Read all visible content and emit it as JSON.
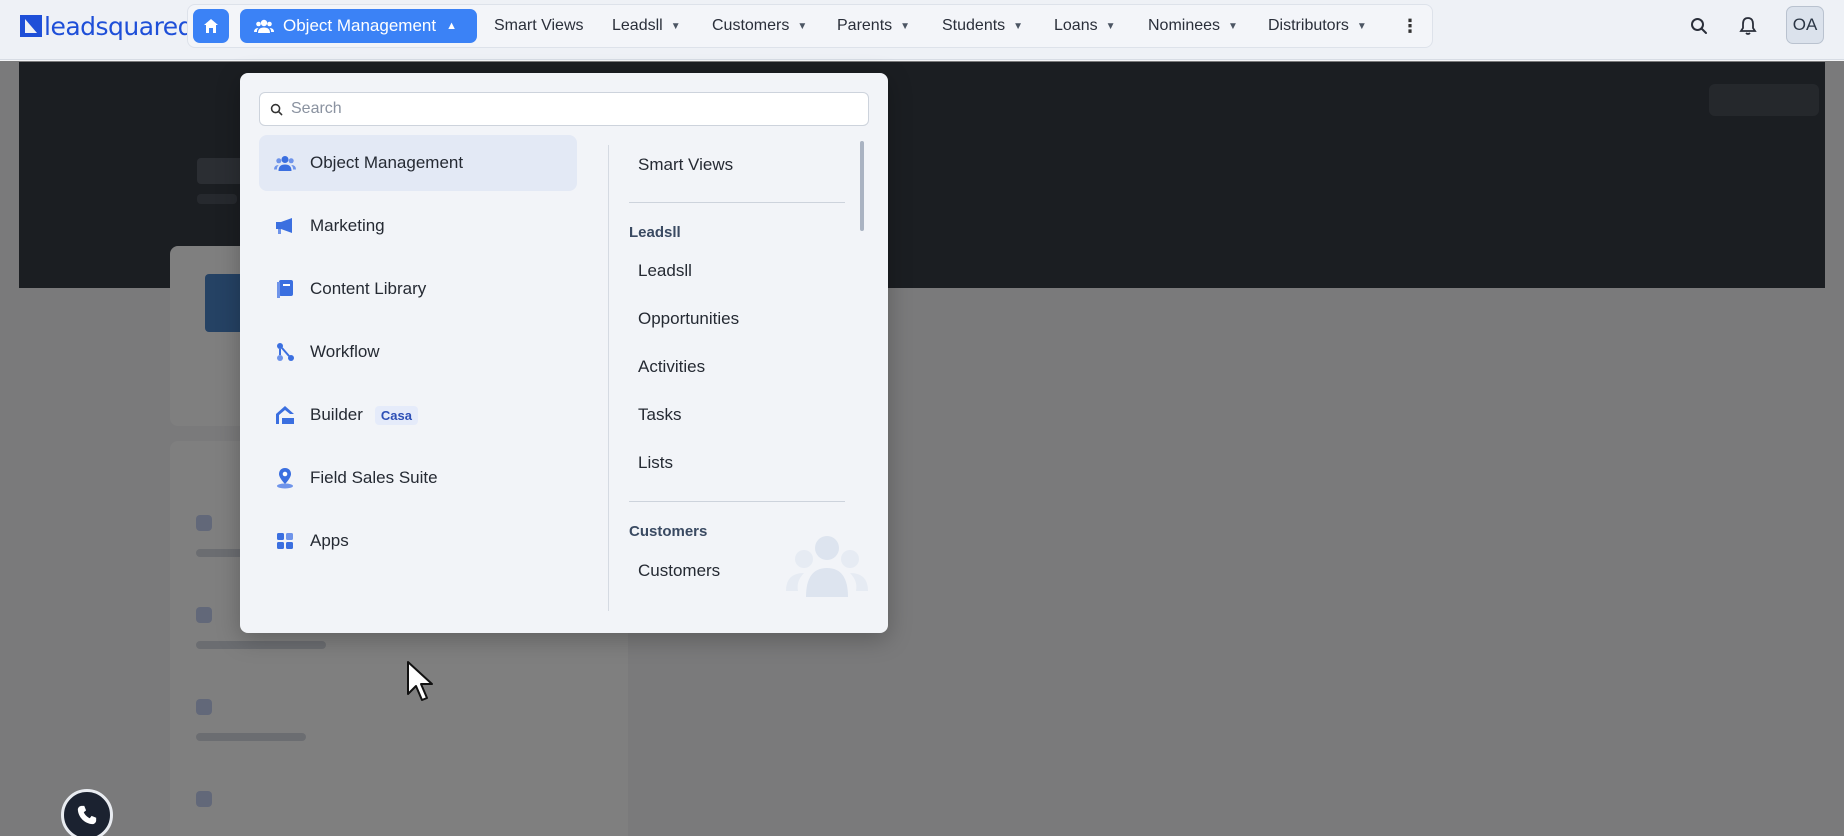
{
  "brand": {
    "logo_text": "leadsquared"
  },
  "topnav": {
    "active_menu": "Object Management",
    "items": [
      {
        "label": "Smart Views",
        "has_dropdown": false
      },
      {
        "label": "Leadsll",
        "has_dropdown": true
      },
      {
        "label": "Customers",
        "has_dropdown": true
      },
      {
        "label": "Parents",
        "has_dropdown": true
      },
      {
        "label": "Students",
        "has_dropdown": true
      },
      {
        "label": "Loans",
        "has_dropdown": true
      },
      {
        "label": "Nominees",
        "has_dropdown": true
      },
      {
        "label": "Distributors",
        "has_dropdown": true
      }
    ],
    "avatar_initials": "OA"
  },
  "dropdown": {
    "search_placeholder": "Search",
    "categories": [
      {
        "label": "Object Management",
        "icon": "users-icon",
        "active": true
      },
      {
        "label": "Marketing",
        "icon": "megaphone-icon"
      },
      {
        "label": "Content Library",
        "icon": "book-icon"
      },
      {
        "label": "Workflow",
        "icon": "workflow-icon"
      },
      {
        "label": "Builder",
        "icon": "builder-icon",
        "badge": "Casa"
      },
      {
        "label": "Field Sales Suite",
        "icon": "map-pin-icon"
      },
      {
        "label": "Apps",
        "icon": "apps-grid-icon"
      }
    ],
    "submenu": {
      "top_item": "Smart Views",
      "group_leads": {
        "heading": "Leadsll",
        "items": [
          "Leadsll",
          "Opportunities",
          "Activities",
          "Tasks",
          "Lists"
        ]
      },
      "group_customers": {
        "heading": "Customers",
        "items": [
          "Customers"
        ]
      }
    }
  },
  "colors": {
    "accent": "#3b82f6",
    "brand": "#1e4fd8",
    "overlay": "rgba(0,0,0,0.5)"
  }
}
